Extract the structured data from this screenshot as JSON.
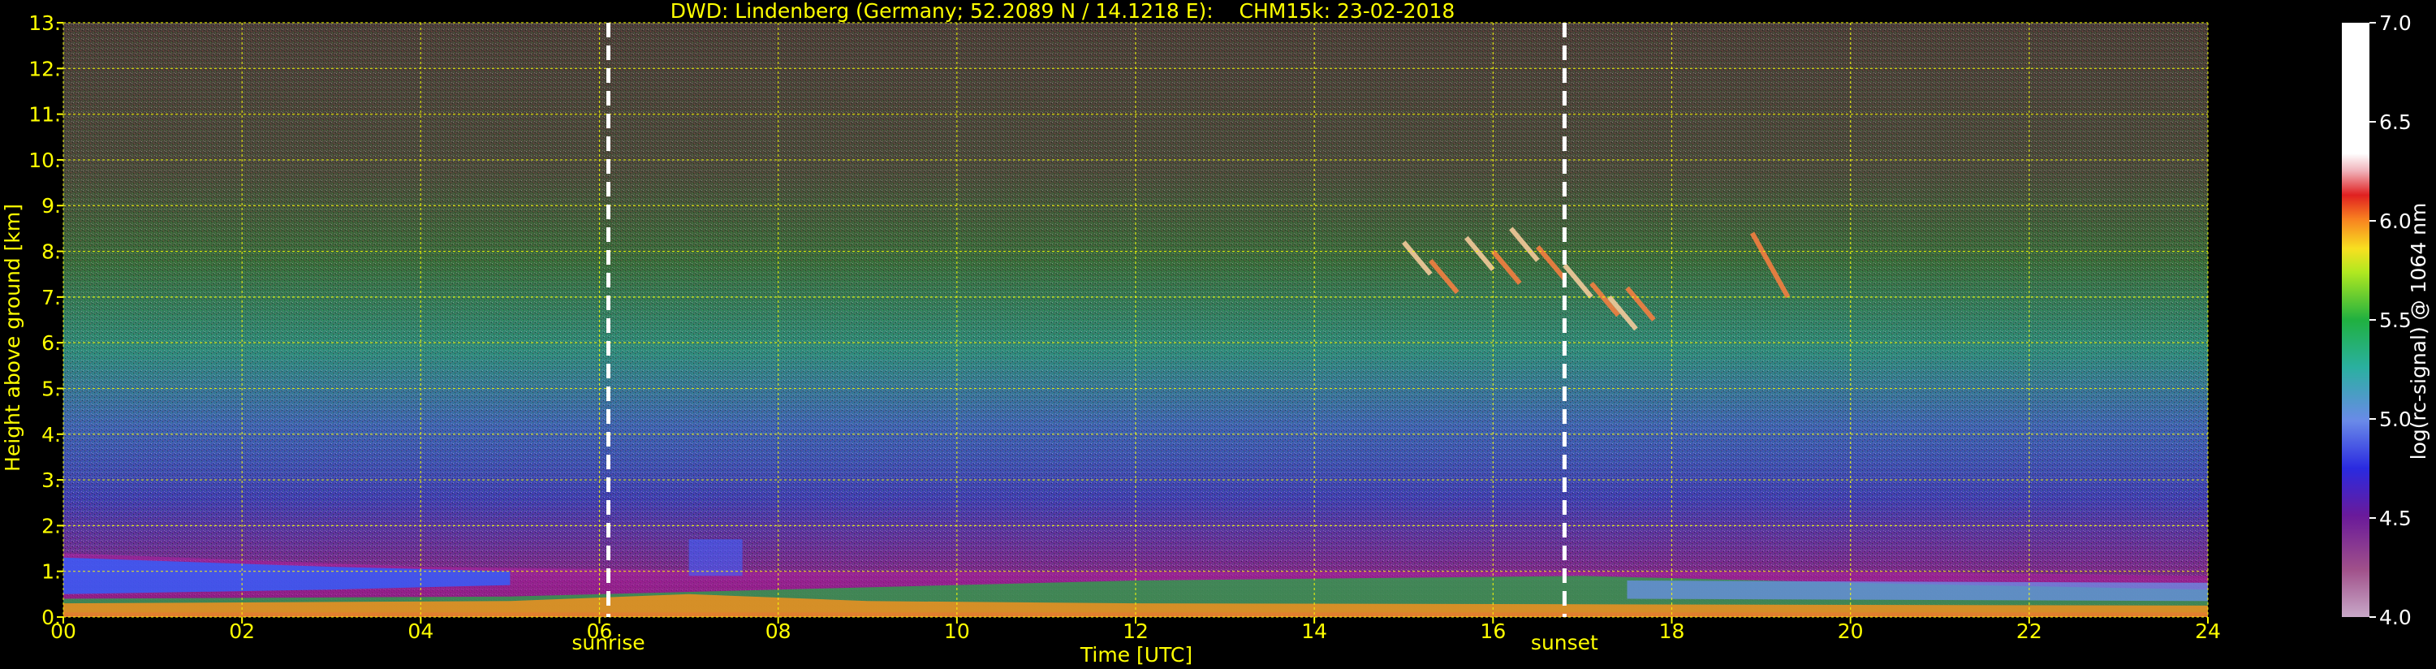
{
  "chart_data": {
    "type": "heatmap",
    "title": "DWD: Lindenberg (Germany; 52.2089 N / 14.1218 E):    CHM15k: 23-02-2018",
    "xlabel": "Time [UTC]",
    "ylabel": "Height above ground [km]",
    "xlim": [
      0,
      24
    ],
    "ylim": [
      0,
      13
    ],
    "x_ticks": [
      "00",
      "02",
      "04",
      "06",
      "08",
      "10",
      "12",
      "14",
      "16",
      "18",
      "20",
      "22",
      "24"
    ],
    "y_ticks": [
      "0.",
      "1.",
      "2.",
      "3.",
      "4.",
      "5.",
      "6.",
      "7.",
      "8.",
      "9.",
      "10.",
      "11.",
      "12.",
      "13."
    ],
    "grid": true,
    "markers": [
      {
        "label": "sunrise",
        "x": 6.1
      },
      {
        "label": "sunset",
        "x": 16.8
      }
    ],
    "colorbar": {
      "label": "log(rc-signal) @ 1064 nm",
      "range": [
        4.0,
        7.0
      ],
      "ticks": [
        "4.0",
        "4.5",
        "5.0",
        "5.5",
        "6.0",
        "6.5",
        "7.0"
      ]
    },
    "colors": {
      "axis_text": "#ffff00",
      "grid": "#ffff00",
      "marker_line": "#ffffff",
      "colorbar_text": "#ffffff"
    }
  }
}
